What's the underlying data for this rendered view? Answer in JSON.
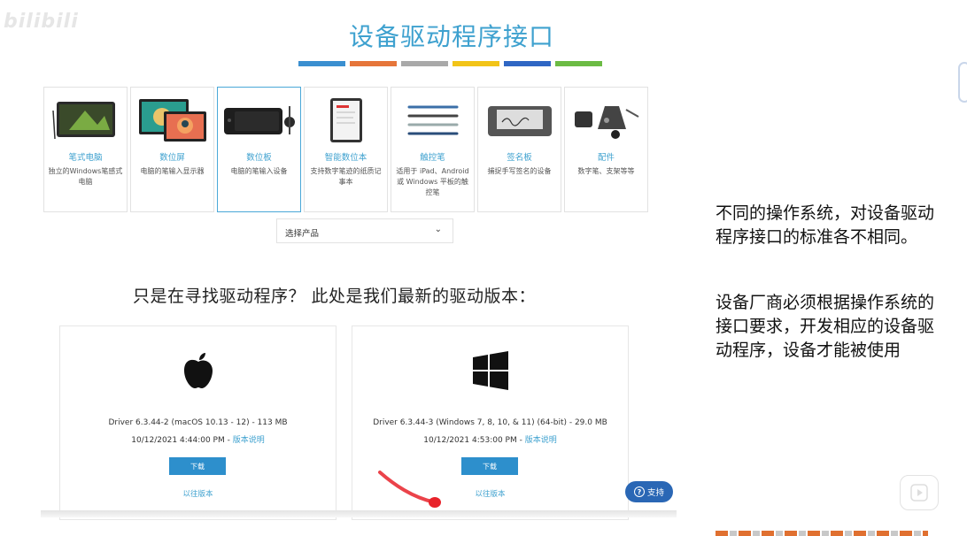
{
  "watermark": "bilibili",
  "page": {
    "title": "设备驱动程序接口",
    "colorbar": [
      "#3b8fd0",
      "#e6753a",
      "#a9a9a9",
      "#f2c418",
      "#2f66c4",
      "#6bbb44"
    ],
    "accent": "#3ea1cf"
  },
  "products": [
    {
      "title": "笔式电脑",
      "desc": "独立的Windows笔感式电脑",
      "icon": "pen-computer-icon"
    },
    {
      "title": "数位屏",
      "desc": "电脑的笔输入显示器",
      "icon": "pen-display-icon"
    },
    {
      "title": "数位板",
      "desc": "电脑的笔输入设备",
      "icon": "pen-tablet-icon"
    },
    {
      "title": "智能数位本",
      "desc": "支持数字笔迹的纸质记事本",
      "icon": "smartpad-icon"
    },
    {
      "title": "触控笔",
      "desc": "适用于 iPad、Android 或 Windows 平板的触控笔",
      "icon": "stylus-icon"
    },
    {
      "title": "签名板",
      "desc": "捕捉手写签名的设备",
      "icon": "signature-pad-icon"
    },
    {
      "title": "配件",
      "desc": "数字笔、支架等等",
      "icon": "accessories-icon"
    }
  ],
  "selector": {
    "label": "选择产品"
  },
  "drivers": {
    "heading": "只是在寻找驱动程序？ 此处是我们最新的驱动版本：",
    "mac": {
      "name": "Driver 6.3.44-2 (macOS 10.13 - 12) - 113 MB",
      "date": "10/12/2021 4:44:00 PM - ",
      "notes": "版本说明",
      "download": "下载",
      "previous": "以往版本"
    },
    "win": {
      "name": "Driver 6.3.44-3 (Windows 7, 8, 10, & 11) (64-bit) - 29.0 MB",
      "date": "10/12/2021 4:53:00 PM - ",
      "notes": "版本说明",
      "download": "下载",
      "previous": "以往版本"
    }
  },
  "help": {
    "label": "支持"
  },
  "notes": {
    "n1": "不同的操作系统，对设备驱动程序接口的标准各不相同。",
    "n2": "设备厂商必须根据操作系统的接口要求，开发相应的设备驱动程序，设备才能被使用"
  }
}
